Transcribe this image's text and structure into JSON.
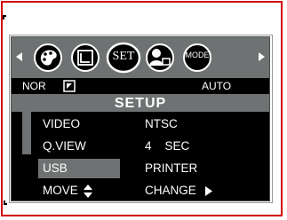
{
  "menu": {
    "mode_badge": "NOR",
    "auto_badge": "AUTO",
    "title": "SETUP",
    "set_label": "SET",
    "mode_label": "MODE",
    "items": [
      {
        "label": "VIDEO",
        "value": "NTSC"
      },
      {
        "label": "Q.VIEW",
        "value": "4    SEC"
      },
      {
        "label": "USB",
        "value": "PRINTER"
      }
    ],
    "footer_left": "MOVE",
    "footer_right": "CHANGE"
  },
  "colors": {
    "frame": "#d40000",
    "screen": "#6e7272",
    "menu_bg": "#000000",
    "text": "#ffffff"
  },
  "icons": [
    "left-arrow-icon",
    "palette-icon",
    "frame-icon",
    "set-icon",
    "person-icon",
    "mode-icon",
    "right-arrow-icon"
  ]
}
